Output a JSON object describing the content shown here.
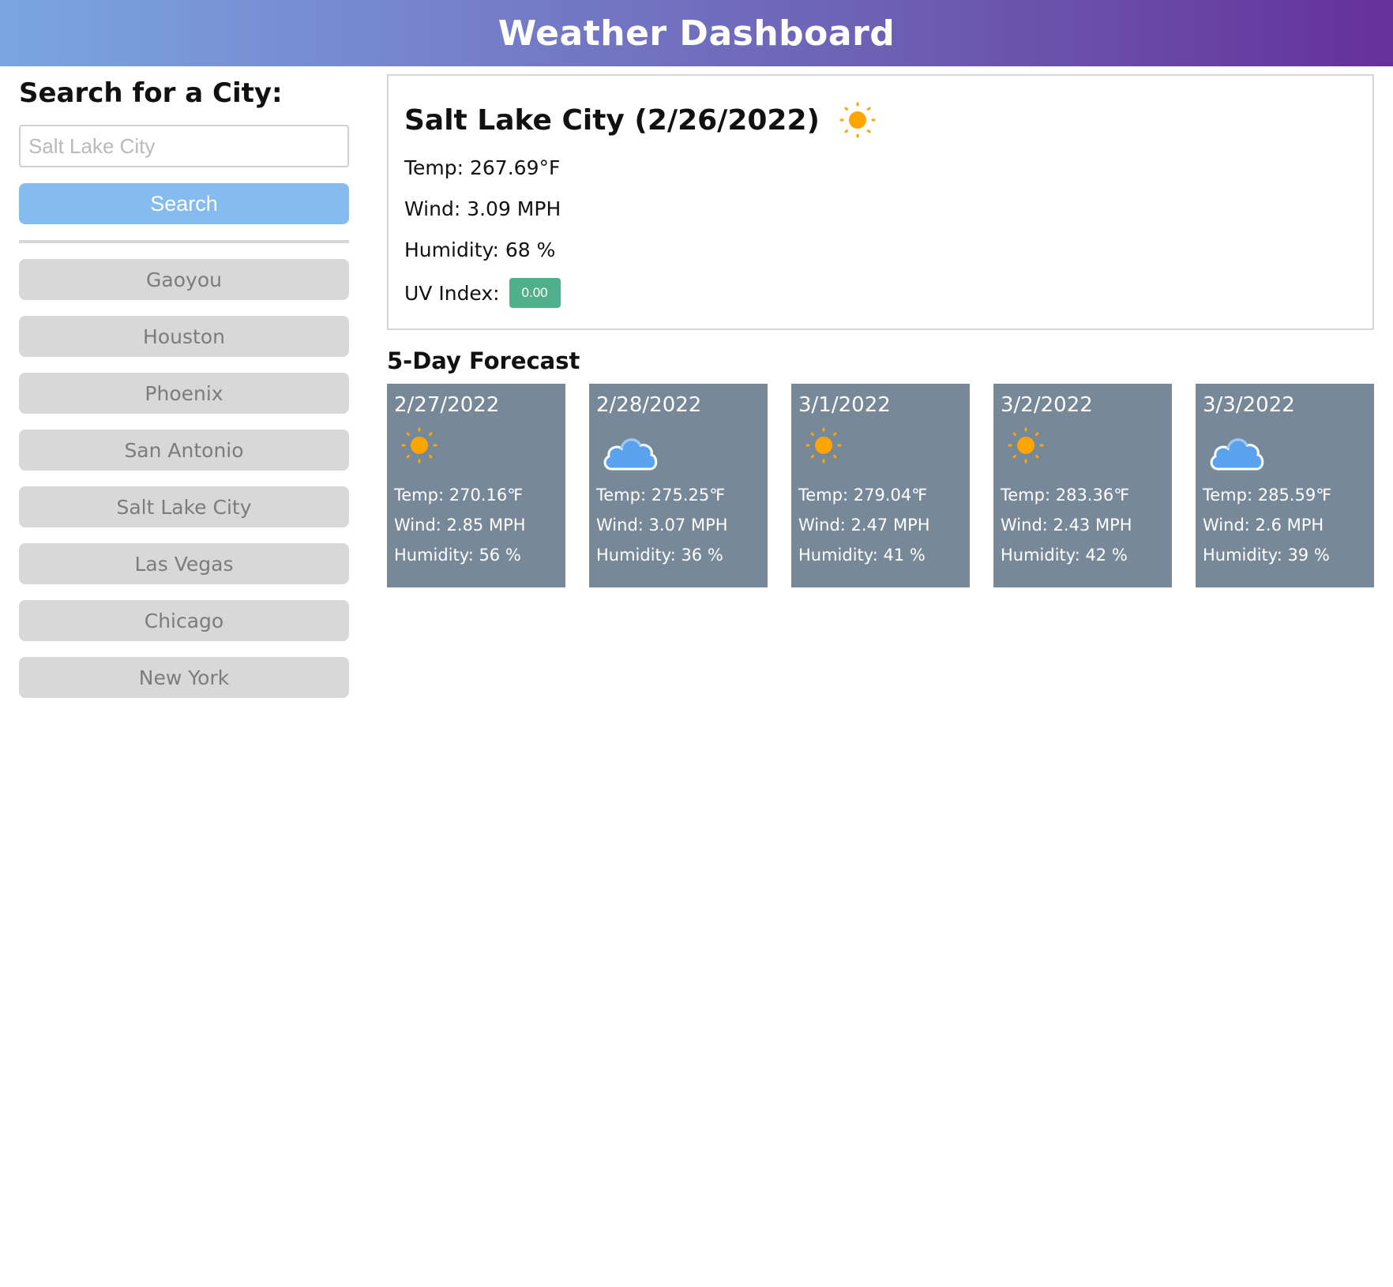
{
  "header": {
    "title": "Weather Dashboard"
  },
  "sidebar": {
    "heading": "Search for a City:",
    "search_placeholder": "Salt Lake City",
    "search_button": "Search",
    "history": [
      "Gaoyou",
      "Houston",
      "Phoenix",
      "San Antonio",
      "Salt Lake City",
      "Las Vegas",
      "Chicago",
      "New York"
    ]
  },
  "current": {
    "title": "Salt Lake City (2/26/2022)",
    "icon": "sun-icon",
    "temp": "Temp: 267.69°F",
    "wind": "Wind: 3.09 MPH",
    "humidity": "Humidity: 68 %",
    "uv_label": "UV Index:",
    "uv_value": "0.00",
    "uv_color": "#50b08c"
  },
  "forecast": {
    "title": "5-Day Forecast",
    "days": [
      {
        "date": "2/27/2022",
        "icon": "sun-icon",
        "temp": "Temp: 270.16℉",
        "wind": "Wind: 2.85 MPH",
        "humidity": "Humidity: 56 %"
      },
      {
        "date": "2/28/2022",
        "icon": "cloud-icon",
        "temp": "Temp: 275.25℉",
        "wind": "Wind: 3.07 MPH",
        "humidity": "Humidity: 36 %"
      },
      {
        "date": "3/1/2022",
        "icon": "sun-icon",
        "temp": "Temp: 279.04℉",
        "wind": "Wind: 2.47 MPH",
        "humidity": "Humidity: 41 %"
      },
      {
        "date": "3/2/2022",
        "icon": "sun-icon",
        "temp": "Temp: 283.36℉",
        "wind": "Wind: 2.43 MPH",
        "humidity": "Humidity: 42 %"
      },
      {
        "date": "3/3/2022",
        "icon": "cloud-icon",
        "temp": "Temp: 285.59℉",
        "wind": "Wind: 2.6 MPH",
        "humidity": "Humidity: 39 %"
      }
    ]
  },
  "colors": {
    "header_gradient_start": "#7aa6e0",
    "header_gradient_end": "#65319a",
    "search_button": "#84bcef",
    "history_button": "#d8d8d8",
    "forecast_card": "#778899",
    "sun": "#ffa500",
    "cloud": "#5aa2ee"
  }
}
